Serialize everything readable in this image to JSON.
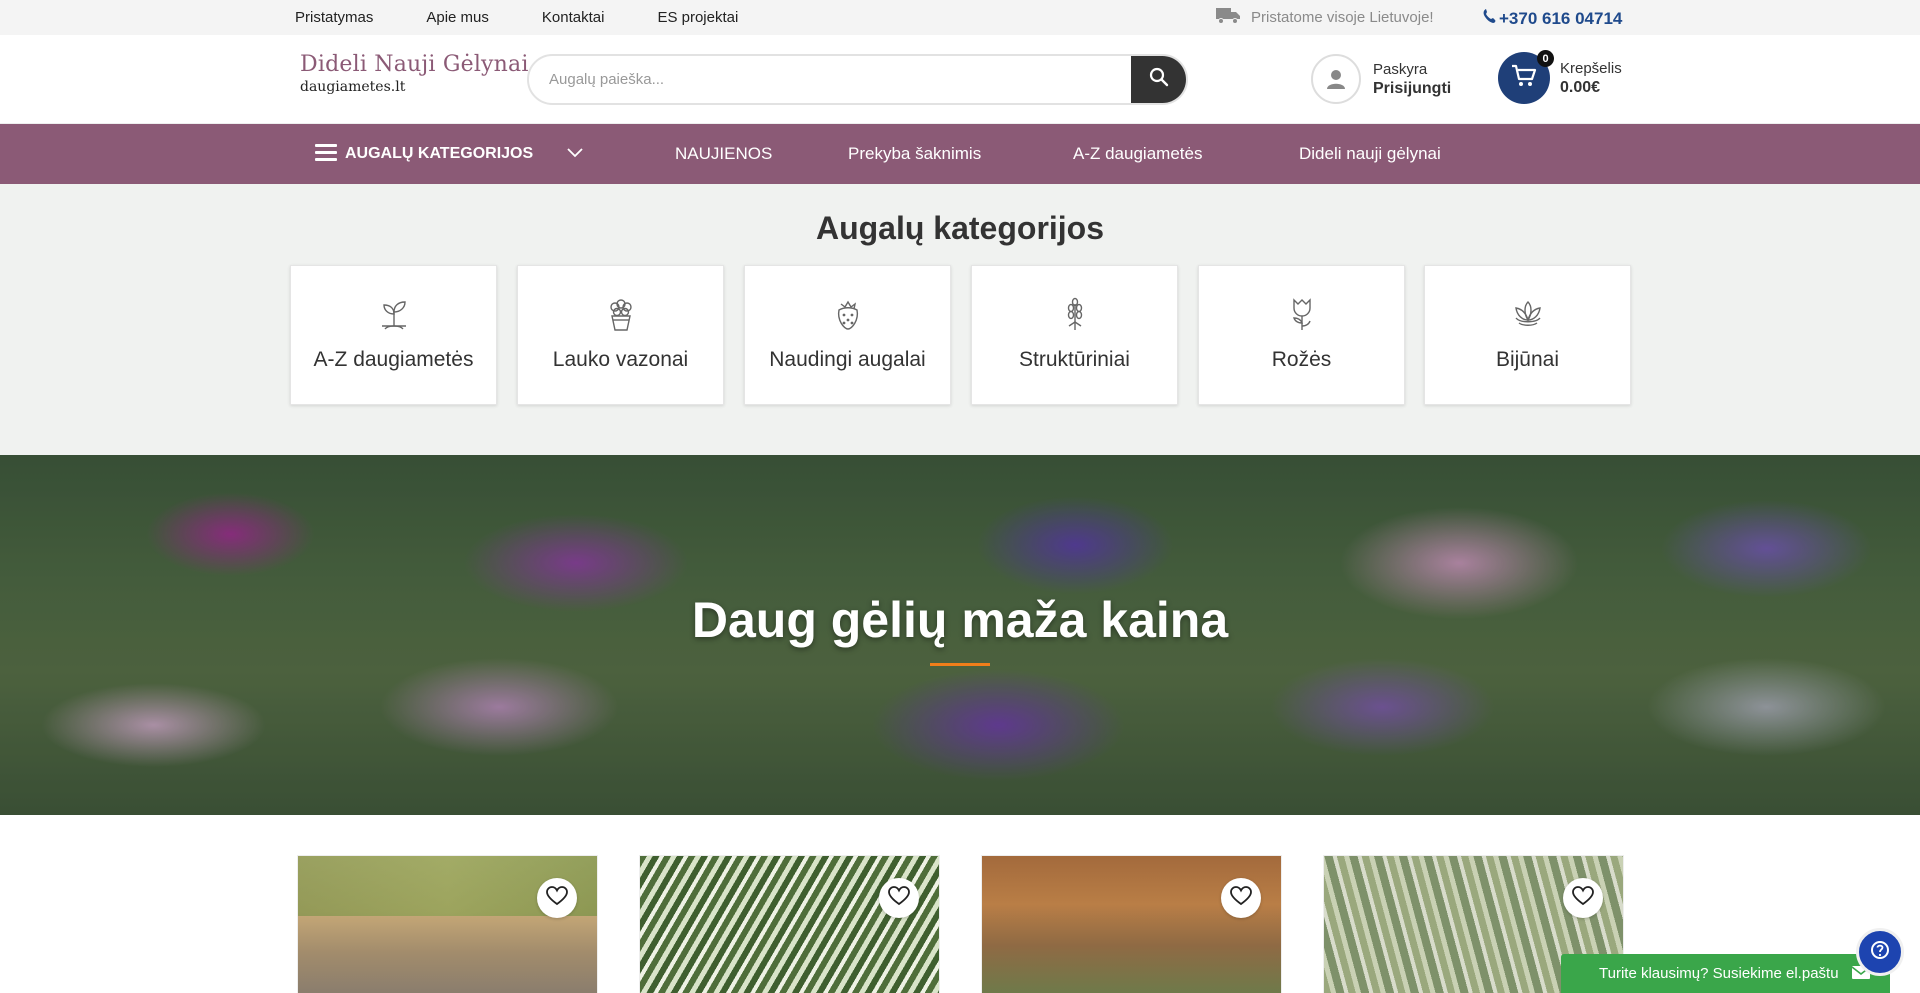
{
  "topbar": {
    "links": [
      "Pristatymas",
      "Apie mus",
      "Kontaktai",
      "ES projektai"
    ],
    "shipping_text": "Pristatome visoje Lietuvoje!",
    "phone": "+370 616 04714"
  },
  "header": {
    "logo_line1": "Dideli Nauji Gėlynai",
    "logo_line2": "daugiametes.lt",
    "search_placeholder": "Augalų paieška...",
    "account_label": "Paskyra",
    "account_action": "Prisijungti",
    "cart_label": "Krepšelis",
    "cart_total": "0.00€",
    "cart_count": "0"
  },
  "nav": {
    "categories_label": "AUGALŲ KATEGORIJOS",
    "items": [
      "NAUJIENOS",
      "Prekyba šaknimis",
      "A-Z daugiametės",
      "Dideli nauji gėlynai"
    ]
  },
  "categories": {
    "title": "Augalų kategorijos",
    "items": [
      {
        "label": "A-Z daugiametės",
        "icon": "sprout-icon"
      },
      {
        "label": "Lauko vazonai",
        "icon": "flower-pot-icon"
      },
      {
        "label": "Naudingi augalai",
        "icon": "strawberry-icon"
      },
      {
        "label": "Struktūriniai",
        "icon": "grass-plant-icon"
      },
      {
        "label": "Rožės",
        "icon": "rose-icon"
      },
      {
        "label": "Bijūnai",
        "icon": "peony-icon"
      }
    ]
  },
  "hero": {
    "title": "Daug gėlių maža kaina",
    "accent": "#f07e1a"
  },
  "products": {
    "count_visible": 4
  },
  "contact_widget": {
    "text": "Turite klausimų? Susiekime el.paštu"
  },
  "colors": {
    "brand": "#8b5a76",
    "cart": "#1f3f78",
    "phone": "#1f4a8c",
    "contact": "#3aa64a"
  }
}
